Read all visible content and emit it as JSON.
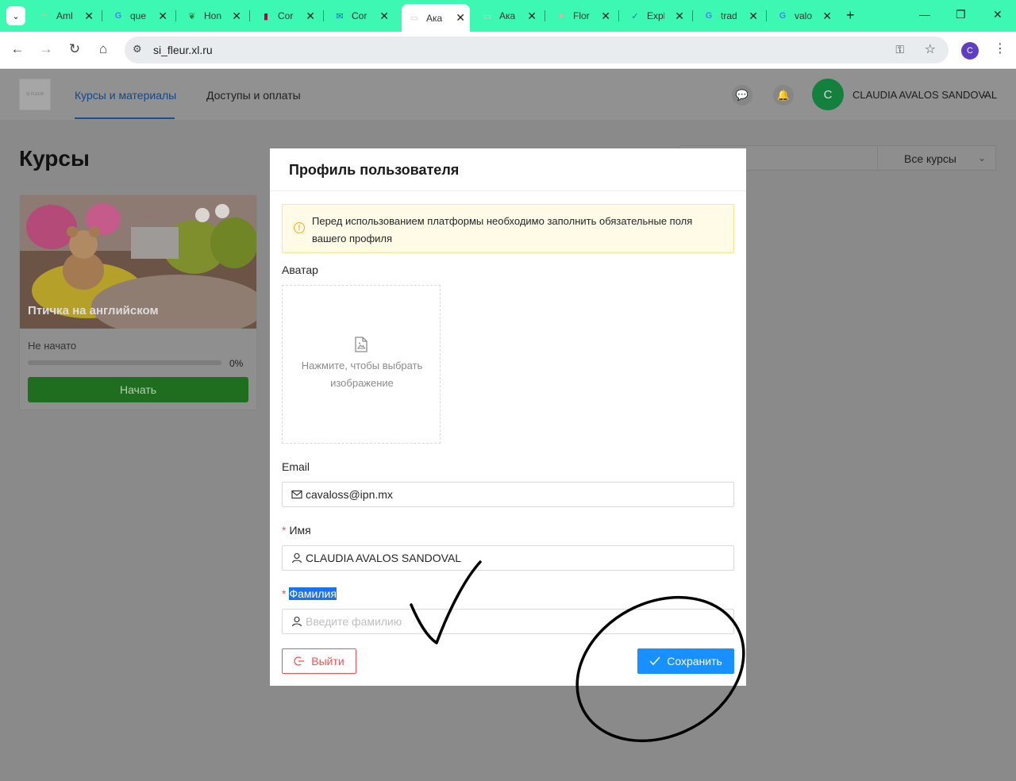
{
  "browser": {
    "tabs": [
      {
        "title": "Aml",
        "favicon_color": "#f6b26b",
        "favicon_glyph": "◓"
      },
      {
        "title": "que",
        "favicon_color": "#4285f4",
        "favicon_glyph": "G"
      },
      {
        "title": "Hon",
        "favicon_color": "#2e7d32",
        "favicon_glyph": "❦"
      },
      {
        "title": "Cor",
        "favicon_color": "#b3004b",
        "favicon_glyph": "▮"
      },
      {
        "title": "Cor",
        "favicon_color": "#0f6cbd",
        "favicon_glyph": "✉"
      },
      {
        "title": "Ака",
        "favicon_color": "#cfcfcf",
        "favicon_glyph": "▭",
        "active": true
      },
      {
        "title": "Ака",
        "favicon_color": "#cfcfcf",
        "favicon_glyph": "▭"
      },
      {
        "title": "Flor",
        "favicon_color": "#f0a8a8",
        "favicon_glyph": "●"
      },
      {
        "title": "Expl",
        "favicon_color": "#2b6cb0",
        "favicon_glyph": "✓"
      },
      {
        "title": "trad",
        "favicon_color": "#4285f4",
        "favicon_glyph": "G"
      },
      {
        "title": "valo",
        "favicon_color": "#4285f4",
        "favicon_glyph": "G"
      }
    ],
    "url": "si_fleur.xl.ru",
    "profile_initial": "C"
  },
  "header": {
    "logo_text": "SI FLEUR",
    "nav": [
      {
        "label": "Курсы и материалы",
        "active": true
      },
      {
        "label": "Доступы и оплаты",
        "active": false
      }
    ],
    "user_initial": "C",
    "user_name": "CLAUDIA AVALOS SANDOVAL"
  },
  "main": {
    "title": "Курсы",
    "filter_select": "Все курсы",
    "course": {
      "name": "Птичка на английском",
      "status": "Не начато",
      "progress_percent": 0,
      "progress_label": "0%",
      "start_label": "Начать"
    }
  },
  "modal": {
    "title": "Профиль пользователя",
    "alert": "Перед использованием платформы необходимо заполнить обязательные поля вашего профиля",
    "avatar_label": "Аватар",
    "avatar_hint": "Нажмите, чтобы выбрать изображение",
    "email_label": "Email",
    "email_value": "cavaloss@ipn.mx",
    "first_name_label": "Имя",
    "first_name_value": "CLAUDIA AVALOS SANDOVAL",
    "last_name_label": "Фамилия",
    "last_name_placeholder": "Введите фамилию",
    "logout_label": "Выйти",
    "save_label": "Сохранить"
  },
  "colors": {
    "tabbar": "#3df8b2",
    "primary": "#1890ff",
    "danger": "#ff4d4f",
    "warning_bg": "#fffbe6",
    "annotation": "#000000"
  }
}
